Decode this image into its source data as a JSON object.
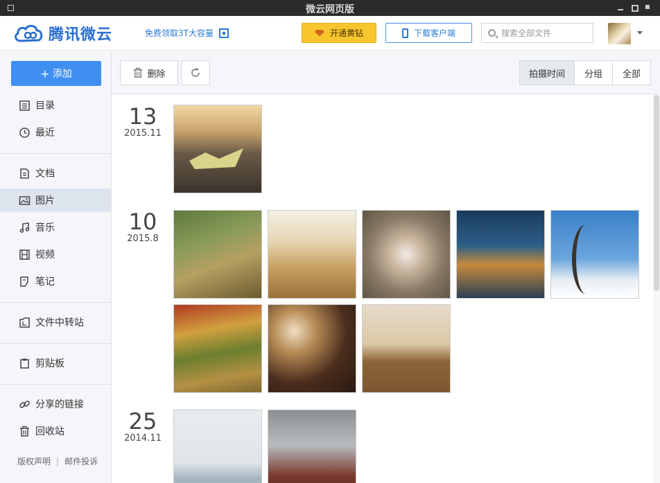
{
  "window": {
    "title": "微云网页版"
  },
  "header": {
    "logo_text": "腾讯微云",
    "promo": "免费领取3T大容量",
    "vip_button": "开通黄钻",
    "download_button": "下载客户端",
    "search": {
      "placeholder": "搜索全部文件",
      "value": ""
    }
  },
  "sidebar": {
    "add_button": "添加",
    "items": [
      {
        "label": "目录",
        "icon": "list-icon"
      },
      {
        "label": "最近",
        "icon": "clock-icon"
      },
      {
        "label": "文档",
        "icon": "document-icon"
      },
      {
        "label": "图片",
        "icon": "image-icon",
        "active": true
      },
      {
        "label": "音乐",
        "icon": "music-icon"
      },
      {
        "label": "视频",
        "icon": "video-icon"
      },
      {
        "label": "笔记",
        "icon": "note-icon"
      },
      {
        "label": "文件中转站",
        "icon": "transfer-icon"
      },
      {
        "label": "剪贴板",
        "icon": "clipboard-icon"
      },
      {
        "label": "分享的链接",
        "icon": "link-icon"
      },
      {
        "label": "回收站",
        "icon": "trash-icon"
      }
    ],
    "footer": {
      "copyright": "版权声明",
      "complaint": "邮件投诉"
    }
  },
  "toolbar": {
    "delete_label": "删除",
    "views": {
      "time": "拍摄时间",
      "group": "分组",
      "all": "全部"
    },
    "active_view": "time"
  },
  "groups": [
    {
      "day": "13",
      "ym": "2015.11",
      "photos": [
        "paper-boat-on-pebbles"
      ]
    },
    {
      "day": "10",
      "ym": "2015.8",
      "photos": [
        "grassy-hill-fence",
        "wheat-field",
        "white-blossoms-bee",
        "night-canal-city",
        "bare-tree-sky",
        "colorful-terraced-fields",
        "paper-lanterns-interior",
        "dusk-field"
      ]
    },
    {
      "day": "25",
      "ym": "2014.11",
      "photos": [
        "cyclist-by-sea",
        "tokyo-tower"
      ]
    }
  ],
  "colors": {
    "accent": "#3f8ff0",
    "vip": "#f7c62f",
    "link": "#2b7bd6"
  }
}
